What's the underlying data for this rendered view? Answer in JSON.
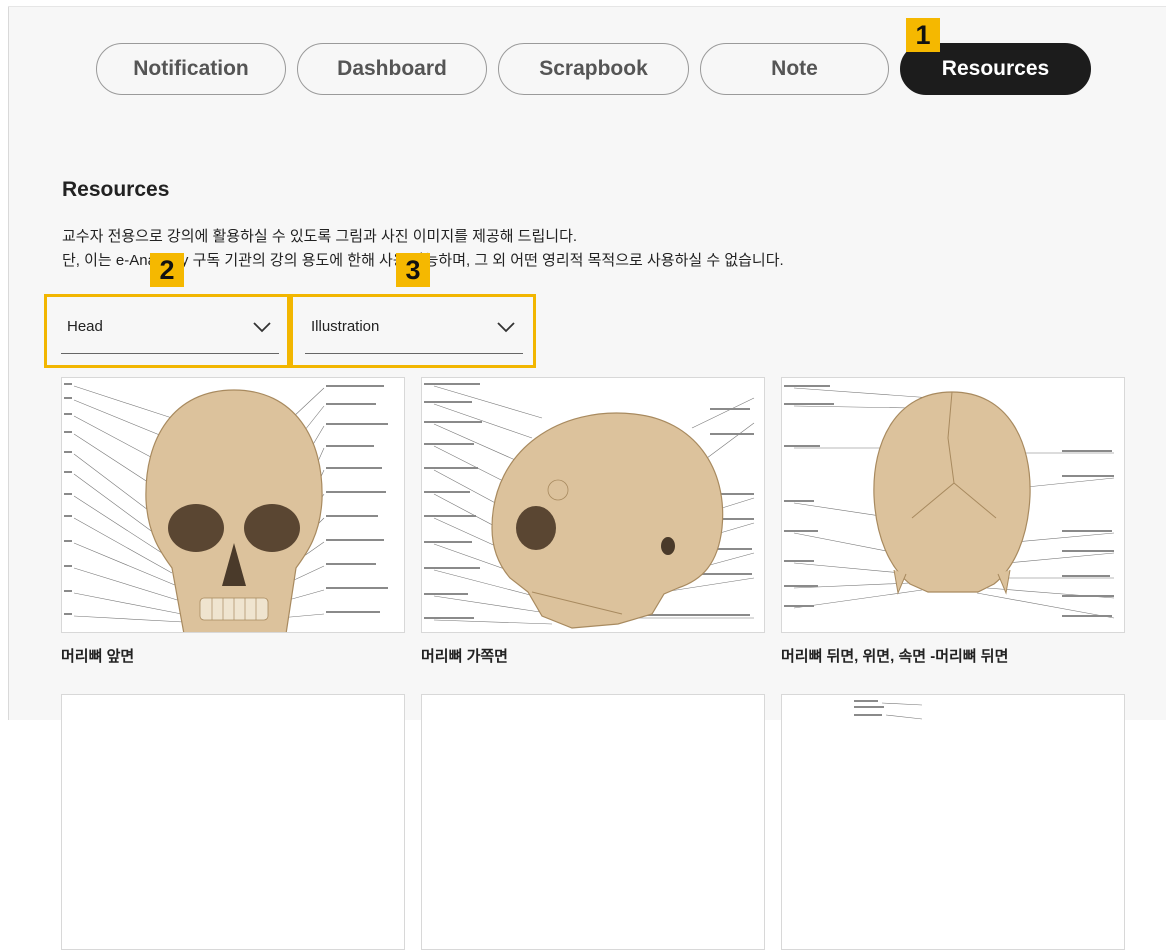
{
  "tabs": [
    {
      "label": "Notification",
      "active": false
    },
    {
      "label": "Dashboard",
      "active": false
    },
    {
      "label": "Scrapbook",
      "active": false
    },
    {
      "label": "Note",
      "active": false
    },
    {
      "label": "Resources",
      "active": true
    }
  ],
  "badges": [
    "1",
    "2",
    "3"
  ],
  "section": {
    "title": "Resources",
    "description_line1": "교수자 전용으로 강의에 활용하실 수 있도록 그림과 사진 이미지를 제공해 드립니다.",
    "description_line2": "단, 이는 e-Anatomy 구독 기관의 강의 용도에 한해 사용 가능하며, 그 외 어떤 영리적 목적으로 사용하실 수 없습니다."
  },
  "filters": {
    "region": {
      "selected": "Head"
    },
    "type": {
      "selected": "Illustration"
    }
  },
  "resources": [
    {
      "title": "머리뼈 앞면",
      "image": "skull-anterior-illustration"
    },
    {
      "title": "머리뼈 가쪽면",
      "image": "skull-lateral-illustration"
    },
    {
      "title": "머리뼈 뒤면, 위면, 속면 -머리뼈 뒤면",
      "image": "skull-posterior-illustration"
    },
    {
      "title": "",
      "image": "next-illustration"
    },
    {
      "title": "",
      "image": "next-illustration"
    },
    {
      "title": "",
      "image": "next-illustration"
    }
  ],
  "colors": {
    "accent_badge": "#f5b800",
    "active_tab": "#1c1c1c",
    "panel_bg": "#f7f7f7",
    "bone": "#d9bf97"
  },
  "icons": {
    "select_chevron": "chevron-down-icon"
  }
}
